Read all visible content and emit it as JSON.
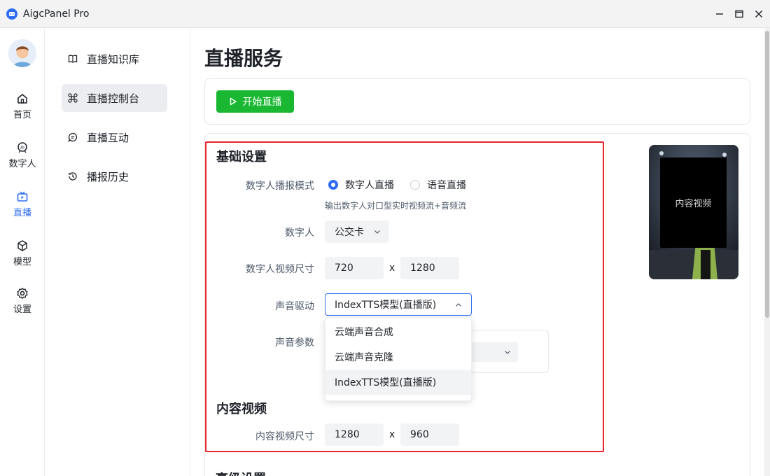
{
  "window": {
    "title": "AigcPanel Pro"
  },
  "rail": {
    "items": [
      {
        "label": "首页",
        "icon": "home-icon"
      },
      {
        "label": "数字人",
        "icon": "ai-person-icon"
      },
      {
        "label": "直播",
        "icon": "tv-icon",
        "active": true
      },
      {
        "label": "模型",
        "icon": "cube-icon"
      },
      {
        "label": "设置",
        "icon": "gear-icon"
      }
    ],
    "accent": "#2d6cf6"
  },
  "subnav": {
    "items": [
      {
        "label": "直播知识库",
        "icon": "book-icon"
      },
      {
        "label": "直播控制台",
        "icon": "command-icon",
        "active": true
      },
      {
        "label": "直播互动",
        "icon": "chat-icon"
      },
      {
        "label": "播报历史",
        "icon": "history-icon"
      }
    ]
  },
  "main": {
    "title": "直播服务",
    "start_button": "开始直播",
    "start_color": "#1ab832",
    "basic": {
      "title": "基础设置",
      "mode_label": "数字人播报模式",
      "mode_options": [
        "数字人直播",
        "语音直播"
      ],
      "mode_selected": "数字人直播",
      "mode_hint": "输出数字人对口型实时视频流+音频流",
      "avatar_label": "数字人",
      "avatar_value": "公交卡",
      "video_size_label": "数字人视频尺寸",
      "video_width": "720",
      "video_height": "1280",
      "times": "x",
      "voice_driver_label": "声音驱动",
      "voice_driver_value": "IndexTTS模型(直播版)",
      "voice_param_label": "声音参数",
      "dropdown_options": [
        "云端声音合成",
        "云端声音克隆",
        "IndexTTS模型(直播版)"
      ]
    },
    "content": {
      "title": "内容视频",
      "size_label": "内容视频尺寸",
      "width": "1280",
      "height": "960"
    },
    "preview": {
      "label": "内容视频"
    },
    "next_section_partial": "高级设置"
  }
}
